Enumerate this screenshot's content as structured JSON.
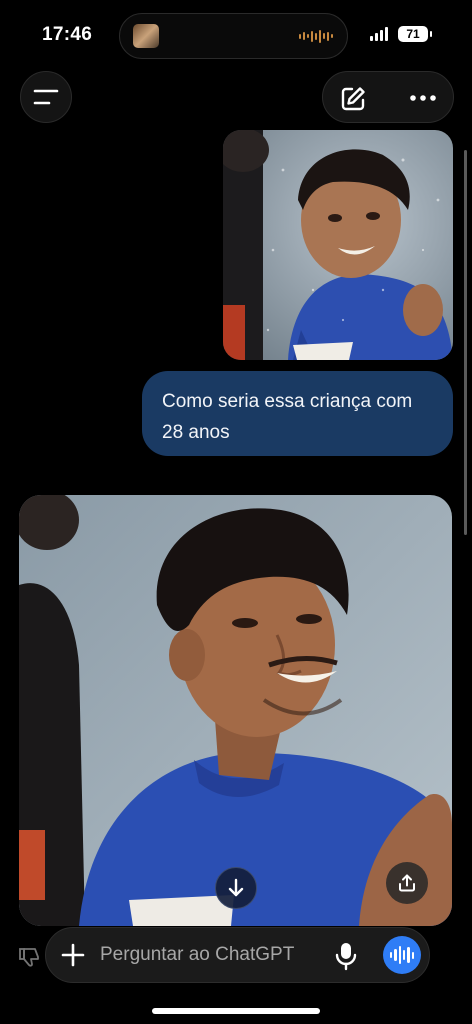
{
  "status_bar": {
    "time": "17:46",
    "battery": "71",
    "icons": [
      "now-playing-thumbnail",
      "audio-waveform-icon",
      "cellular-signal-icon",
      "battery-icon"
    ]
  },
  "nav": {
    "menu_icon": "hamburger-menu-icon",
    "new_chat_icon": "edit-pencil-icon",
    "more_icon": "more-dots-icon"
  },
  "conversation": {
    "user_image": "photo-child",
    "user_message": "Como seria essa criança com 28 anos",
    "assistant_image": "photo-adult"
  },
  "overlay": {
    "scroll_down_icon": "arrow-down-icon",
    "share_icon": "share-upload-icon"
  },
  "composer": {
    "placeholder": "Perguntar ao ChatGPT",
    "value": "",
    "icons": [
      "plus-icon",
      "microphone-icon",
      "voice-mode-icon"
    ]
  },
  "colors": {
    "background": "#000000",
    "bubble": "#1a3a63",
    "voice_button": "#2f7df6"
  }
}
